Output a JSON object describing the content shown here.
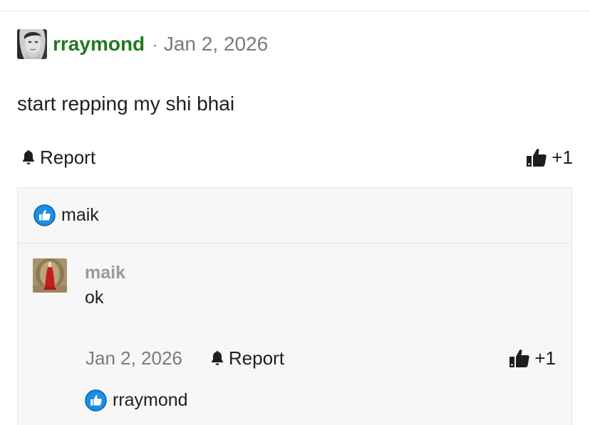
{
  "post": {
    "author": "rraymond",
    "separator": "·",
    "date": "Jan 2, 2026",
    "body": "start repping my shi bhai",
    "report_label": "Report",
    "plus_one_label": "+1",
    "liked_by": "maik"
  },
  "reply": {
    "author": "maik",
    "text": "ok",
    "date": "Jan 2, 2026",
    "report_label": "Report",
    "plus_one_label": "+1",
    "liked_by": "rraymond"
  },
  "colors": {
    "author_green": "#1f7a1f",
    "muted_gray": "#7b7b7b",
    "like_blue": "#1a8fe3",
    "box_bg": "#f7f7f7"
  }
}
